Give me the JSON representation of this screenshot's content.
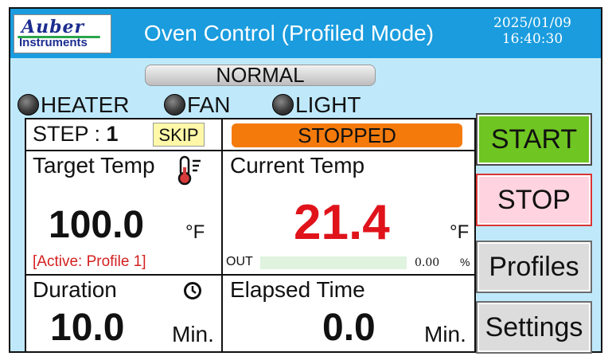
{
  "header": {
    "logo_line1": "Auber",
    "logo_line2": "Instruments",
    "title": "Oven Control (Profiled Mode)",
    "date": "2025/01/09",
    "time": "16:40:30"
  },
  "status": "NORMAL",
  "indicators": [
    {
      "label": "HEATER",
      "state": "off"
    },
    {
      "label": "FAN",
      "state": "off"
    },
    {
      "label": "LIGHT",
      "state": "off"
    }
  ],
  "step": {
    "label": "STEP : ",
    "value": "1",
    "skip_label": "SKIP"
  },
  "run_state": "STOPPED",
  "target": {
    "label": "Target Temp",
    "value": "100.0",
    "unit": "°F",
    "active_profile": "[Active: Profile 1]"
  },
  "current": {
    "label": "Current Temp",
    "value": "21.4",
    "unit": "°F",
    "value_color": "#e0131b"
  },
  "output": {
    "label": "OUT",
    "value": "0.00",
    "unit": "%",
    "bar_fraction": 0.0
  },
  "duration": {
    "label": "Duration",
    "value": "10.0",
    "unit": "Min."
  },
  "elapsed": {
    "label": "Elapsed Time",
    "value": "0.0",
    "unit": "Min."
  },
  "buttons": {
    "start": "START",
    "stop": "STOP",
    "profiles": "Profiles",
    "settings": "Settings"
  },
  "colors": {
    "header": "#1a9cde",
    "background": "#bfe9fb",
    "start": "#6fc521",
    "stop": "#ffd3e0",
    "stopped_badge": "#f47a0c",
    "output_bar": "#8bea8b"
  },
  "icons": {
    "target": "thermometer-icon",
    "duration": "clock-icon"
  }
}
